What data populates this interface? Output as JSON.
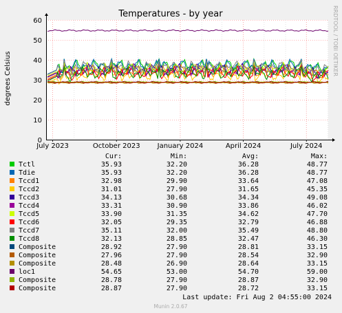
{
  "chart_data": {
    "type": "line",
    "title": "Temperatures - by year",
    "ylabel": "degrees Celsius",
    "ylim": [
      0,
      60
    ],
    "yticks": [
      0,
      10,
      20,
      30,
      40,
      50,
      60
    ],
    "x_range": [
      "2023-06-22",
      "2024-08-02"
    ],
    "xticks": [
      {
        "label": "July 2023",
        "date": "2023-07-01"
      },
      {
        "label": "October 2023",
        "date": "2023-10-01"
      },
      {
        "label": "January 2024",
        "date": "2024-01-01"
      },
      {
        "label": "April 2024",
        "date": "2024-04-01"
      },
      {
        "label": "July 2024",
        "date": "2024-07-01"
      }
    ],
    "grid": true,
    "legend_headers": {
      "cur": "Cur:",
      "min": "Min:",
      "avg": "Avg:",
      "max": "Max:"
    },
    "series": [
      {
        "name": "Tctl",
        "color": "#00cc00",
        "cur": "35.93",
        "min": "32.20",
        "avg": "36.28",
        "max": "48.77"
      },
      {
        "name": "Tdie",
        "color": "#0066b3",
        "cur": "35.93",
        "min": "32.20",
        "avg": "36.28",
        "max": "48.77"
      },
      {
        "name": "Tccd1",
        "color": "#ff8000",
        "cur": "32.98",
        "min": "29.90",
        "avg": "33.64",
        "max": "47.08"
      },
      {
        "name": "Tccd2",
        "color": "#ffcc00",
        "cur": "31.01",
        "min": "27.90",
        "avg": "31.65",
        "max": "45.35"
      },
      {
        "name": "Tccd3",
        "color": "#330099",
        "cur": "34.13",
        "min": "30.68",
        "avg": "34.34",
        "max": "49.08"
      },
      {
        "name": "Tccd4",
        "color": "#990099",
        "cur": "33.31",
        "min": "30.90",
        "avg": "33.86",
        "max": "46.02"
      },
      {
        "name": "Tccd5",
        "color": "#ccff00",
        "cur": "33.90",
        "min": "31.35",
        "avg": "34.62",
        "max": "47.70"
      },
      {
        "name": "Tccd6",
        "color": "#ff0000",
        "cur": "32.05",
        "min": "29.35",
        "avg": "32.79",
        "max": "46.88"
      },
      {
        "name": "Tccd7",
        "color": "#808080",
        "cur": "35.11",
        "min": "32.00",
        "avg": "35.49",
        "max": "48.80"
      },
      {
        "name": "Tccd8",
        "color": "#008f00",
        "cur": "32.13",
        "min": "28.85",
        "avg": "32.47",
        "max": "46.30"
      },
      {
        "name": "Composite",
        "color": "#00487d",
        "cur": "28.92",
        "min": "27.90",
        "avg": "28.81",
        "max": "33.15"
      },
      {
        "name": "Composite",
        "color": "#b35a00",
        "cur": "27.96",
        "min": "27.90",
        "avg": "28.54",
        "max": "32.90"
      },
      {
        "name": "Composite",
        "color": "#b38f00",
        "cur": "28.48",
        "min": "26.90",
        "avg": "28.64",
        "max": "33.15"
      },
      {
        "name": "loc1",
        "color": "#6b006b",
        "cur": "54.65",
        "min": "53.00",
        "avg": "54.70",
        "max": "59.00"
      },
      {
        "name": "Composite",
        "color": "#8fb300",
        "cur": "28.78",
        "min": "27.90",
        "avg": "28.87",
        "max": "32.90"
      },
      {
        "name": "Composite",
        "color": "#b30000",
        "cur": "28.87",
        "min": "27.90",
        "avg": "28.72",
        "max": "33.15"
      }
    ]
  },
  "footer": {
    "last_update": "Last update: Fri Aug  2 04:55:00 2024",
    "version": "Munin 2.0.67"
  },
  "side_label": "RRDTOOL / TOBI OETIKER"
}
